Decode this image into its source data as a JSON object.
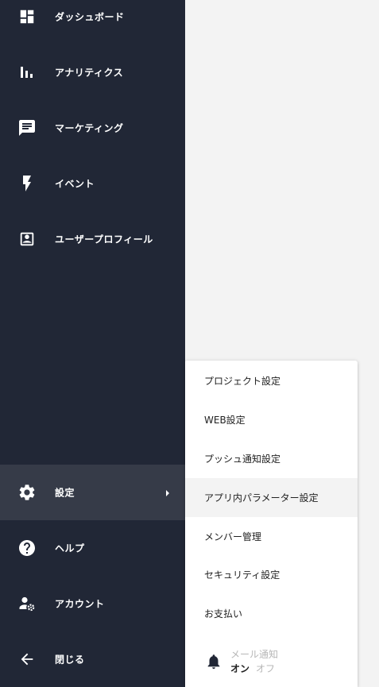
{
  "sidebar": {
    "items": [
      {
        "label": "ダッシュボード",
        "icon": "dashboard-icon"
      },
      {
        "label": "アナリティクス",
        "icon": "bar-chart-icon"
      },
      {
        "label": "マーケティング",
        "icon": "chat-message-icon"
      },
      {
        "label": "イベント",
        "icon": "lightning-bolt-icon"
      },
      {
        "label": "ユーザープロフィール",
        "icon": "user-profile-icon"
      }
    ],
    "bottom_items": [
      {
        "label": "設定",
        "icon": "gear-icon",
        "active": true
      },
      {
        "label": "ヘルプ",
        "icon": "help-icon"
      },
      {
        "label": "アカウント",
        "icon": "account-settings-icon"
      },
      {
        "label": "閉じる",
        "icon": "arrow-left-icon"
      }
    ]
  },
  "settings_menu": {
    "items": [
      {
        "label": "プロジェクト設定"
      },
      {
        "label": "WEB設定"
      },
      {
        "label": "プッシュ通知設定"
      },
      {
        "label": "アプリ内パラメーター設定",
        "highlighted": true
      },
      {
        "label": "メンバー管理"
      },
      {
        "label": "セキュリティ設定"
      },
      {
        "label": "お支払い"
      }
    ],
    "notification": {
      "title": "メール通知",
      "on_label": "オン",
      "off_label": "オフ",
      "icon": "bell-icon",
      "selected": "オン"
    }
  },
  "colors": {
    "sidebar_bg": "#212736",
    "sidebar_active_bg": "#363b48",
    "page_bg": "#f3f3f3",
    "menu_bg": "#ffffff",
    "menu_hover_bg": "#f3f3f3",
    "muted_text": "#b7b7b7"
  }
}
